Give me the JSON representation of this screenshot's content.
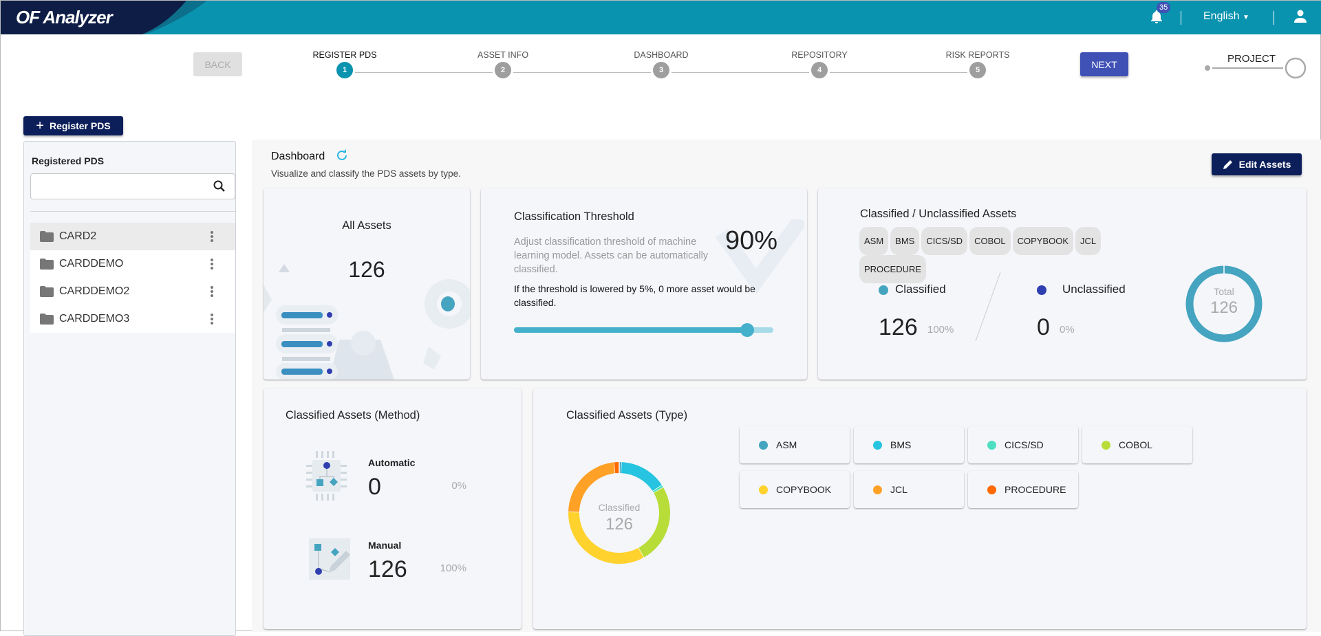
{
  "header": {
    "logo": "OF Analyzer",
    "notification_count": "35",
    "language": "English"
  },
  "nav": {
    "back_label": "BACK",
    "next_label": "NEXT",
    "project_label": "PROJECT",
    "steps": [
      {
        "label": "REGISTER PDS",
        "number": "1",
        "active": true
      },
      {
        "label": "ASSET INFO",
        "number": "2"
      },
      {
        "label": "DASHBOARD",
        "number": "3"
      },
      {
        "label": "REPOSITORY",
        "number": "4"
      },
      {
        "label": "RISK REPORTS",
        "number": "5"
      }
    ]
  },
  "sidebar": {
    "register_label": "Register PDS",
    "panel_title": "Registered PDS",
    "search_value": "",
    "search_placeholder": "",
    "items": [
      {
        "label": "CARD2",
        "selected": true
      },
      {
        "label": "CARDDEMO"
      },
      {
        "label": "CARDDEMO2"
      },
      {
        "label": "CARDDEMO3"
      }
    ]
  },
  "dashboard": {
    "title": "Dashboard",
    "subtitle": "Visualize and classify the PDS assets by type.",
    "edit_label": "Edit Assets",
    "all_assets": {
      "title": "All Assets",
      "value": "126"
    },
    "threshold": {
      "title": "Classification Threshold",
      "description": "Adjust classification threshold of machine learning model. Assets can be automatically classified.",
      "value": "90%",
      "value_num": 90,
      "note": "If the threshold is lowered by 5%, 0 more asset would be classified."
    },
    "classified": {
      "title": "Classified / Unclassified Assets",
      "tags": [
        "ASM",
        "BMS",
        "CICS/SD",
        "COBOL",
        "COPYBOOK",
        "JCL",
        "PROCEDURE"
      ],
      "classified_label": "Classified",
      "classified_value": "126",
      "classified_pct": "100%",
      "unclassified_label": "Unclassified",
      "unclassified_value": "0",
      "unclassified_pct": "0%",
      "total_label": "Total",
      "total_value": "126",
      "classified_color": "#45a4bf",
      "unclassified_color": "#2f3fb0"
    },
    "method": {
      "title": "Classified Assets (Method)",
      "automatic_label": "Automatic",
      "automatic_value": "0",
      "automatic_pct": "0%",
      "manual_label": "Manual",
      "manual_value": "126",
      "manual_pct": "100%"
    },
    "type": {
      "title": "Classified Assets (Type)",
      "center_label": "Classified",
      "center_value": "126"
    }
  },
  "chart_data": {
    "type": "pie",
    "title": "Classified Assets (Type)",
    "donut": true,
    "categories": [
      "ASM",
      "BMS",
      "CICS/SD",
      "COBOL",
      "COPYBOOK",
      "JCL",
      "PROCEDURE"
    ],
    "values": [
      1,
      19,
      1,
      32,
      42,
      29,
      2
    ],
    "colors": [
      "#45a4bf",
      "#26c4e0",
      "#4ddfc0",
      "#b8dc38",
      "#ffd22e",
      "#ffa127",
      "#ff6a00"
    ],
    "legend_placement": "right"
  }
}
